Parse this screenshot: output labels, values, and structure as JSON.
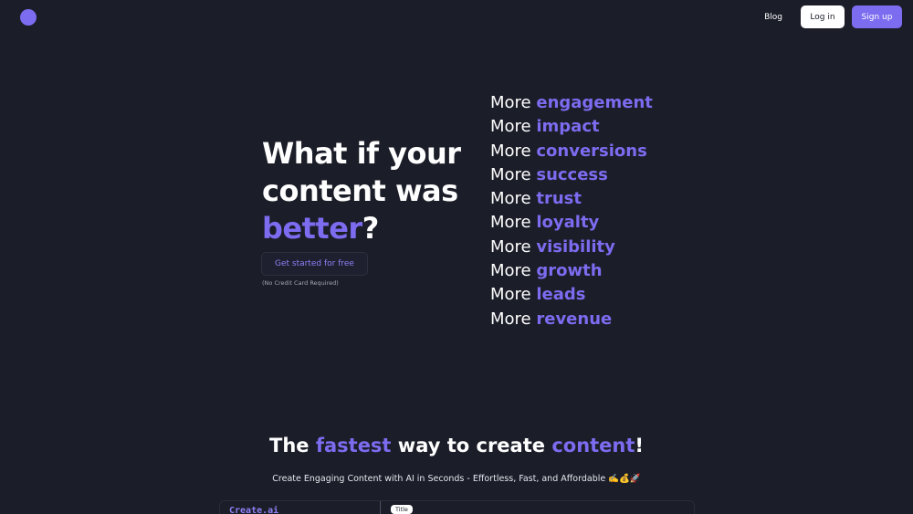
{
  "header": {
    "logo": "logo-circle",
    "nav_blog": "Blog",
    "login_label": "Log in",
    "signup_label": "Sign up"
  },
  "hero": {
    "title_line1": "What if your",
    "title_line2": "content was",
    "title_accent": "better",
    "title_end": "?",
    "cta_label": "Get started for free",
    "cta_note": "(No Credit Card Required)",
    "more_prefix": "More",
    "more_items": [
      "engagement",
      "impact",
      "conversions",
      "success",
      "trust",
      "loyalty",
      "visibility",
      "growth",
      "leads",
      "revenue"
    ]
  },
  "section": {
    "title_part1": "The ",
    "title_accent1": "fastest",
    "title_part2": " way to create ",
    "title_accent2": "content",
    "title_end": "!",
    "subtitle": "Create Engaging Content with AI in Seconds - Effortless, Fast, and Affordable ✍️💰🚀"
  },
  "preview": {
    "brand": "Create.ai",
    "tag": "Title"
  },
  "colors": {
    "background": "#1b1d28",
    "accent": "#7c6cf0",
    "text": "#ffffff"
  }
}
